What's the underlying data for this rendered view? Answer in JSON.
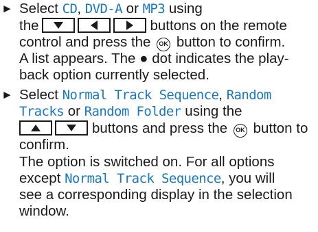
{
  "step1": {
    "bullet": "►",
    "l1_a": "Select ",
    "cd": "CD",
    "l1_b": ", ",
    "dvda": "DVD-A",
    "l1_c": " or ",
    "mp3": "MP3",
    "l1_d": " using",
    "l2_a": "the",
    "l2_b": "buttons on the remote",
    "l3_a": "control and press the",
    "ok_label": "OK",
    "l3_b": "button to confirm.",
    "l4": "A list appears. The ● dot indicates the play-",
    "l5": "back option currently selected."
  },
  "step2": {
    "bullet": "►",
    "l1_a": "Select ",
    "normal": "Normal Track Sequence",
    "l1_b": ", ",
    "random1": "Random",
    "random2": "Tracks",
    "l2_a": " or ",
    "randomfolder": "Random Folder",
    "l2_b": " using the",
    "l3_a": "buttons and press the",
    "ok_label": "OK",
    "l3_b": "button to",
    "l4": "confirm.",
    "l5": "The option is switched on. For all options",
    "l6_a": "except ",
    "normal2": "Normal Track Sequence",
    "l6_b": ", you will",
    "l7": "see a corresponding display in the selection",
    "l8": "window."
  }
}
